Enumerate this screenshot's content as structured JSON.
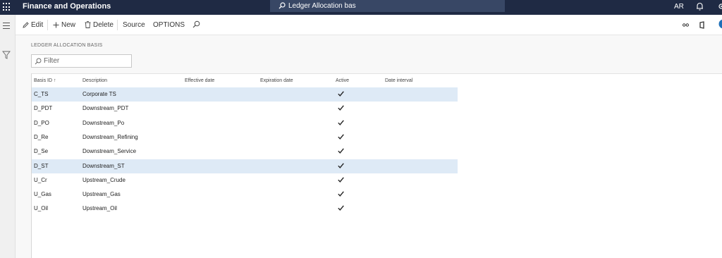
{
  "topbar": {
    "app_title": "Finance and Operations",
    "search_text": "Ledger Allocation bas",
    "user_initials": "AR"
  },
  "actionbar": {
    "edit": "Edit",
    "new": "New",
    "delete": "Delete",
    "source": "Source",
    "options": "OPTIONS"
  },
  "page": {
    "section_title": "LEDGER ALLOCATION BASIS",
    "filter_placeholder": "Filter"
  },
  "grid": {
    "columns": [
      "Basis ID ↑",
      "Description",
      "Effective date",
      "Expiration date",
      "Active",
      "Date interval"
    ],
    "rows": [
      {
        "id": "C_TS",
        "description": "Corporate TS",
        "active": true,
        "selected": true
      },
      {
        "id": "D_PDT",
        "description": "Downstream_PDT",
        "active": true,
        "selected": false
      },
      {
        "id": "D_PO",
        "description": "Downstream_Po",
        "active": true,
        "selected": false
      },
      {
        "id": "D_Re",
        "description": "Downstream_Refining",
        "active": true,
        "selected": false
      },
      {
        "id": "D_Se",
        "description": "Downstream_Service",
        "active": true,
        "selected": false
      },
      {
        "id": "D_ST",
        "description": "Downstream_ST",
        "active": true,
        "selected": true
      },
      {
        "id": "U_Cr",
        "description": "Upstream_Crude",
        "active": true,
        "selected": false
      },
      {
        "id": "U_Gas",
        "description": "Upstream_Gas",
        "active": true,
        "selected": false
      },
      {
        "id": "U_Oil",
        "description": "Upstream_Oil",
        "active": true,
        "selected": false
      }
    ]
  },
  "colors": {
    "topbar": "#1f2a44",
    "search_box": "#384765",
    "selected_row": "#deeaf6"
  }
}
